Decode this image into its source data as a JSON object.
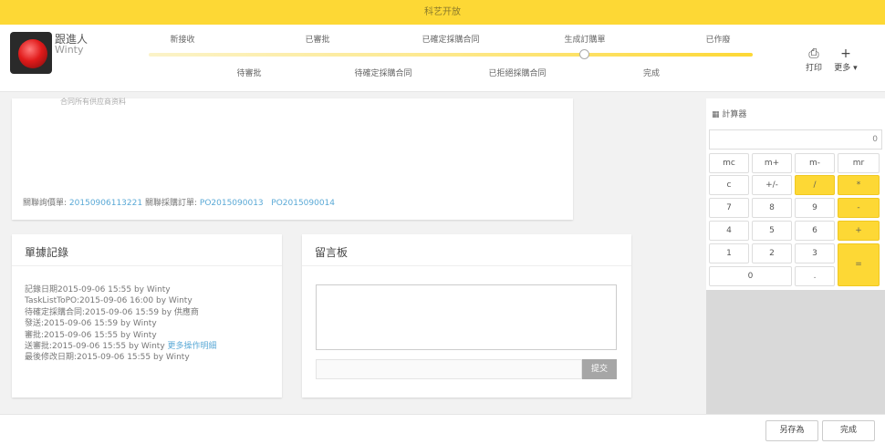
{
  "topbar": {
    "title": "科艺开放"
  },
  "user": {
    "name": "跟進人",
    "subname": "Winty"
  },
  "stages": [
    {
      "label": "新接收"
    },
    {
      "label": "待審批"
    },
    {
      "label": "已審批"
    },
    {
      "label": "待確定採購合同"
    },
    {
      "label": "已確定採購合同"
    },
    {
      "label": "已拒絕採購合同"
    },
    {
      "label": "生成訂購單"
    },
    {
      "label": "完成"
    },
    {
      "label": "已作廢"
    }
  ],
  "tools": {
    "print": "打印",
    "more": "更多"
  },
  "top_card": {
    "faint_line": "合同所有供应商资料",
    "rel_label1": "關聯詢價單:",
    "rel_link1": "20150906113221",
    "rel_label2": "關聯採購訂單:",
    "rel_link2": "PO2015090013",
    "rel_link3": "PO2015090014"
  },
  "records": {
    "title": "單據記錄",
    "lines": [
      "記錄日期2015-09-06 15:55 by Winty",
      "TaskListToPO:2015-09-06 16:00 by Winty",
      "待確定採購合同:2015-09-06 15:59 by 供應商",
      "發送:2015-09-06 15:59 by Winty",
      "審批:2015-09-06 15:55 by Winty",
      "送審批:2015-09-06 15:55 by Winty"
    ],
    "more_link": "更多操作明細",
    "last_line": "最後修改日期:2015-09-06 15:55 by Winty"
  },
  "message": {
    "title": "留言板",
    "submit": "提交"
  },
  "calculator": {
    "title": "計算器",
    "display": "0",
    "row1": [
      "mc",
      "m+",
      "m-",
      "mr"
    ],
    "row2": [
      "c",
      "+/-",
      "/",
      "*"
    ],
    "row3": [
      "7",
      "8",
      "9",
      "-"
    ],
    "row4": [
      "4",
      "5",
      "6",
      "+"
    ],
    "row5": [
      "1",
      "2",
      "3"
    ],
    "row6": [
      "0",
      "."
    ],
    "equals": "="
  },
  "footer": {
    "save_as": "另存為",
    "done": "完成"
  },
  "colors": {
    "accent": "#fdd835",
    "link": "#5aa9d6"
  }
}
